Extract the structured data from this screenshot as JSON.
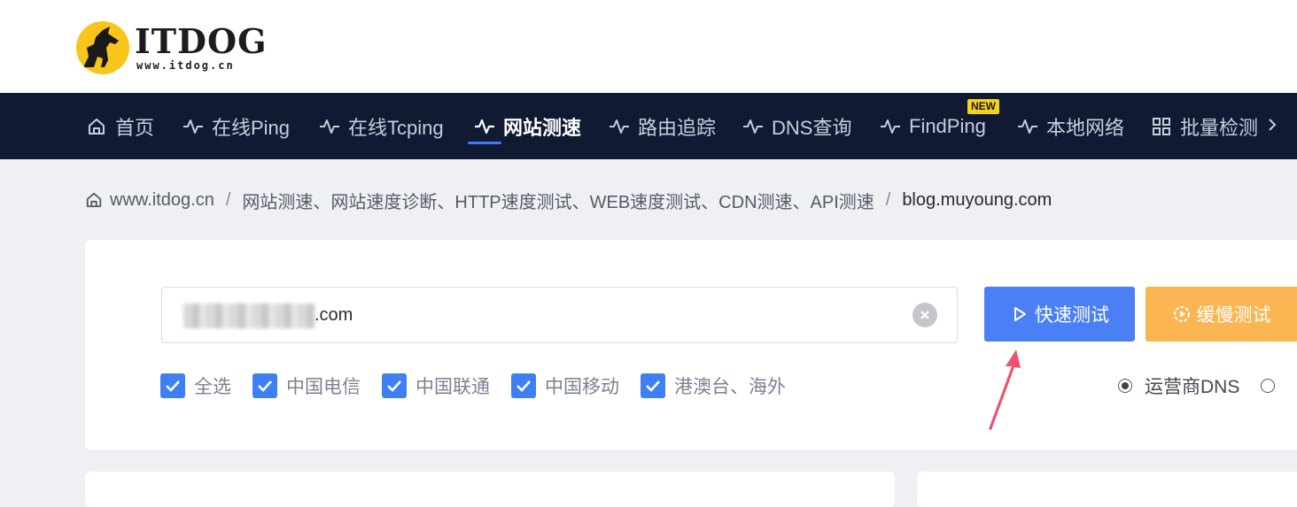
{
  "brand": {
    "title": "ITDOG",
    "subtitle": "www.itdog.cn",
    "accent": "#f7c51b"
  },
  "nav": {
    "items": [
      {
        "label": "首页",
        "icon": "home-icon"
      },
      {
        "label": "在线Ping",
        "icon": "pulse-icon"
      },
      {
        "label": "在线Tcping",
        "icon": "pulse-icon"
      },
      {
        "label": "网站测速",
        "icon": "pulse-icon",
        "active": true
      },
      {
        "label": "路由追踪",
        "icon": "pulse-icon"
      },
      {
        "label": "DNS查询",
        "icon": "pulse-icon"
      },
      {
        "label": "FindPing",
        "icon": "pulse-icon",
        "badge": "NEW"
      },
      {
        "label": "本地网络",
        "icon": "pulse-icon"
      },
      {
        "label": "批量检测",
        "icon": "grid-icon"
      }
    ],
    "bg": "#101a33",
    "active_color": "#3d7bf7"
  },
  "breadcrumb": {
    "home": "www.itdog.cn",
    "section": "网站测速、网站速度诊断、HTTP速度测试、WEB速度测试、CDN测速、API测速",
    "current": "blog.muyoung.com",
    "separator": "/"
  },
  "search": {
    "value_visible": ".com"
  },
  "buttons": {
    "fast": {
      "label": "快速测试",
      "color": "#4a7ff5"
    },
    "slow": {
      "label": "缓慢测试",
      "color": "#fbb552"
    }
  },
  "filters": [
    {
      "label": "全选",
      "checked": true
    },
    {
      "label": "中国电信",
      "checked": true
    },
    {
      "label": "中国联通",
      "checked": true
    },
    {
      "label": "中国移动",
      "checked": true
    },
    {
      "label": "港澳台、海外",
      "checked": true
    }
  ],
  "dns": {
    "options": [
      {
        "label": "运营商DNS",
        "selected": true
      },
      {
        "label": "",
        "selected": false
      }
    ]
  }
}
